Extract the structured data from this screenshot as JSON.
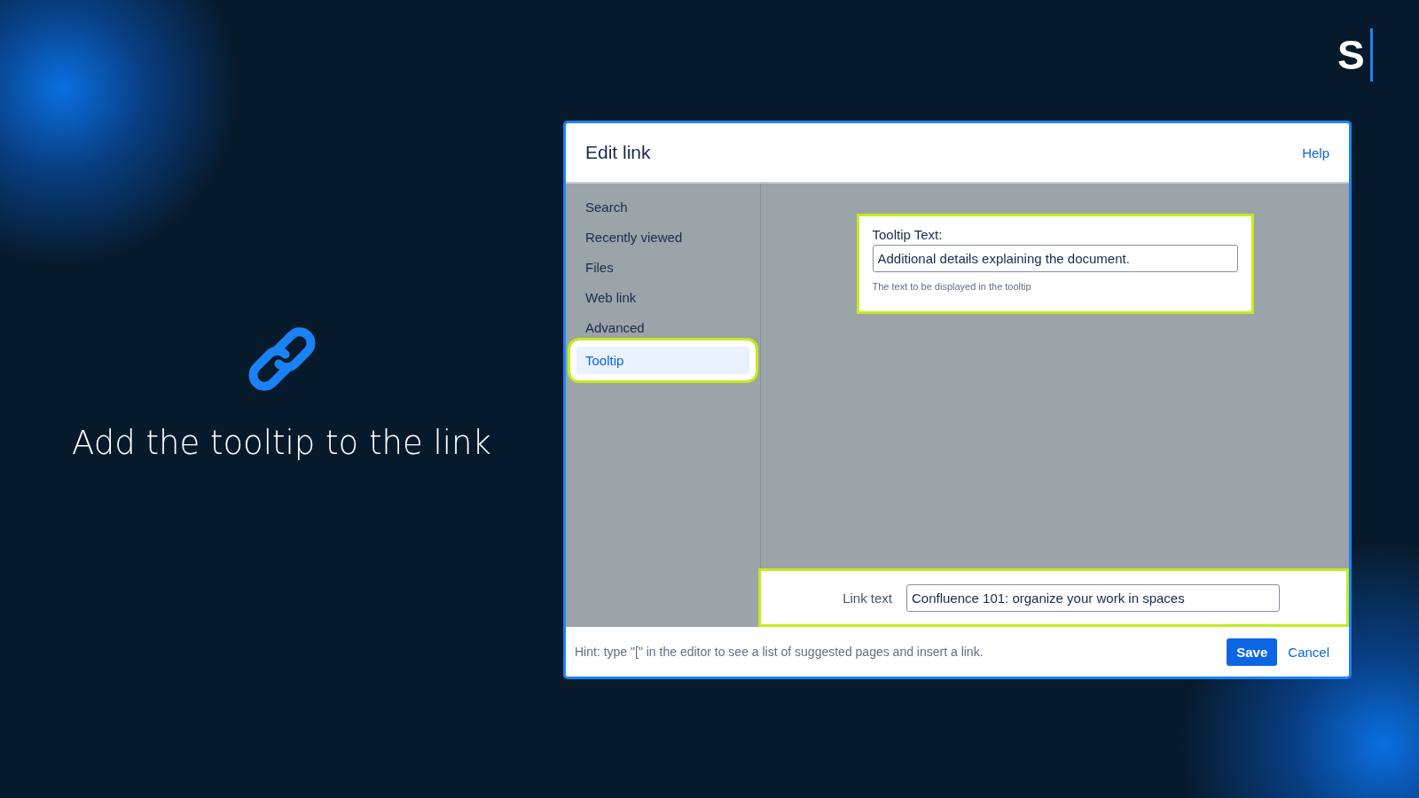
{
  "slide": {
    "caption": "Add the tooltip to the link",
    "logo": "S"
  },
  "dialog": {
    "title": "Edit link",
    "help": "Help",
    "sidebar": [
      {
        "label": "Search",
        "selected": false
      },
      {
        "label": "Recently viewed",
        "selected": false
      },
      {
        "label": "Files",
        "selected": false
      },
      {
        "label": "Web link",
        "selected": false
      },
      {
        "label": "Advanced",
        "selected": false
      },
      {
        "label": "Tooltip",
        "selected": true
      }
    ],
    "tooltip_panel": {
      "label": "Tooltip Text:",
      "value": "Additional details explaining the document.",
      "help_text": "The text to be displayed in the tooltip"
    },
    "link_text": {
      "label": "Link text",
      "value": "Confluence 101: organize your work in spaces"
    },
    "hint": "Hint: type \"[\" in the editor to see a list of suggested pages and insert a link.",
    "buttons": [
      {
        "label": "Save",
        "kind": "primary"
      },
      {
        "label": "Cancel",
        "kind": "link"
      }
    ]
  }
}
